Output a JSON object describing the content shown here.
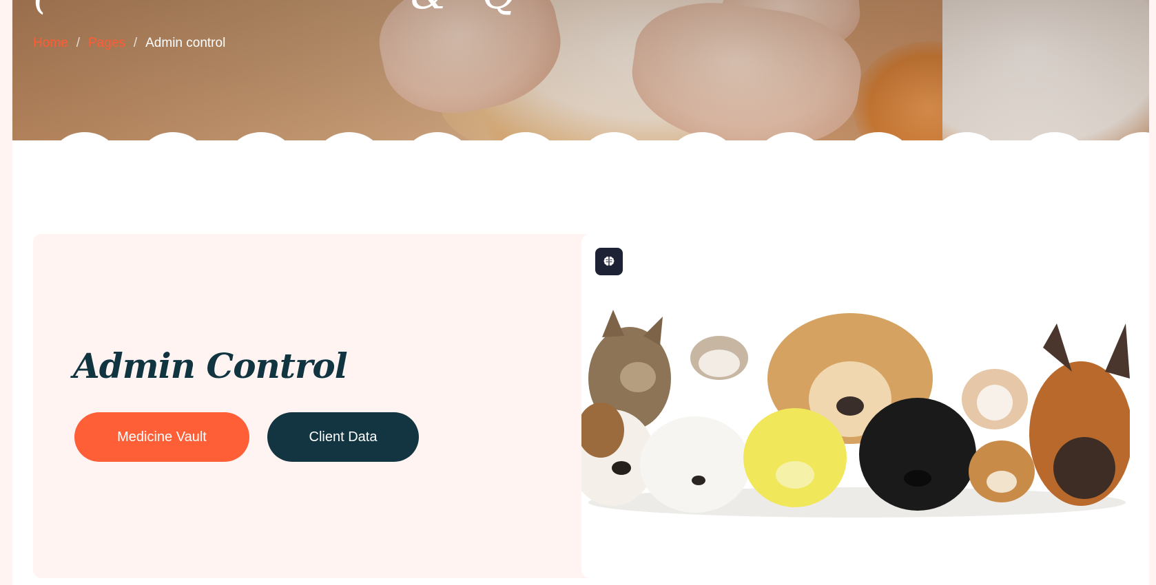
{
  "breadcrumb": {
    "items": [
      "Home",
      "Pages"
    ],
    "separator": "/",
    "current": "Admin control"
  },
  "hero": {
    "title_fragments": [
      "(",
      "&",
      "Q"
    ]
  },
  "admin": {
    "title": "Admin Control",
    "buttons": {
      "medicine_vault": "Medicine Vault",
      "client_data": "Client Data"
    }
  },
  "icons": {
    "badge": "brain-icon"
  },
  "colors": {
    "accent": "#ff5f37",
    "dark": "#123541",
    "page_bg": "#fff4f2",
    "badge_bg": "#1e2235"
  }
}
